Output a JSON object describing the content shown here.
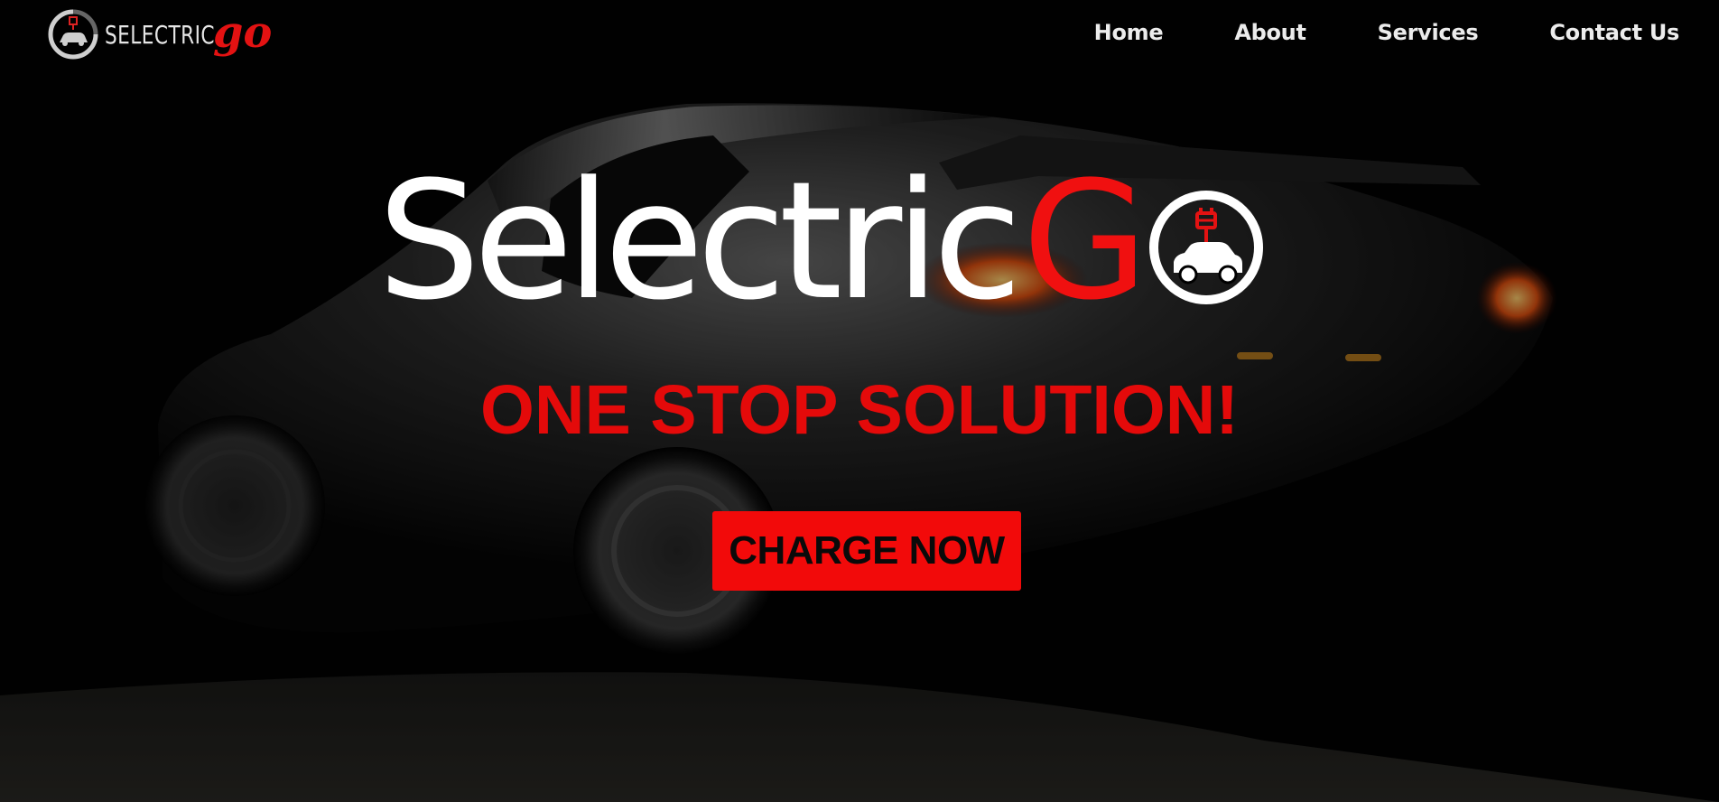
{
  "header": {
    "logo": {
      "word_a": "SELECTRIC",
      "word_b": "go",
      "icon": "car-plug-icon"
    },
    "nav": [
      {
        "label": "Home"
      },
      {
        "label": "About"
      },
      {
        "label": "Services"
      },
      {
        "label": "Contact Us"
      }
    ]
  },
  "hero": {
    "title_a": "Selectric",
    "title_b": "G",
    "title_icon": "car-plug-icon",
    "tagline": "ONE STOP SOLUTION!",
    "cta_label": "CHARGE NOW",
    "background": "dark-sports-car-photo"
  },
  "colors": {
    "brand_red": "#f01010",
    "background": "#020202",
    "text_light": "#ececec",
    "cta_text": "#0a0a0a"
  }
}
